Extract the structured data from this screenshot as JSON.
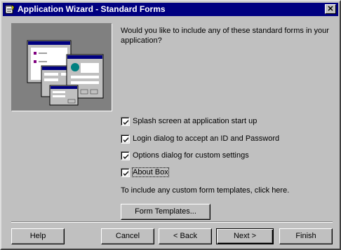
{
  "window": {
    "title": "Application Wizard - Standard Forms",
    "close_glyph": "✕"
  },
  "prompt": "Would you like to include any of these standard forms in your application?",
  "options": [
    {
      "label": "Splash screen at application start up",
      "checked": true
    },
    {
      "label": "Login dialog to accept an ID and Password",
      "checked": true
    },
    {
      "label": "Options dialog for custom settings",
      "checked": true
    },
    {
      "label": "About Box",
      "checked": true
    }
  ],
  "info_text": "To include any custom form templates, click here.",
  "buttons": {
    "form_templates": "Form Templates...",
    "help": "Help",
    "cancel": "Cancel",
    "back": "< Back",
    "next": "Next >",
    "finish": "Finish"
  }
}
